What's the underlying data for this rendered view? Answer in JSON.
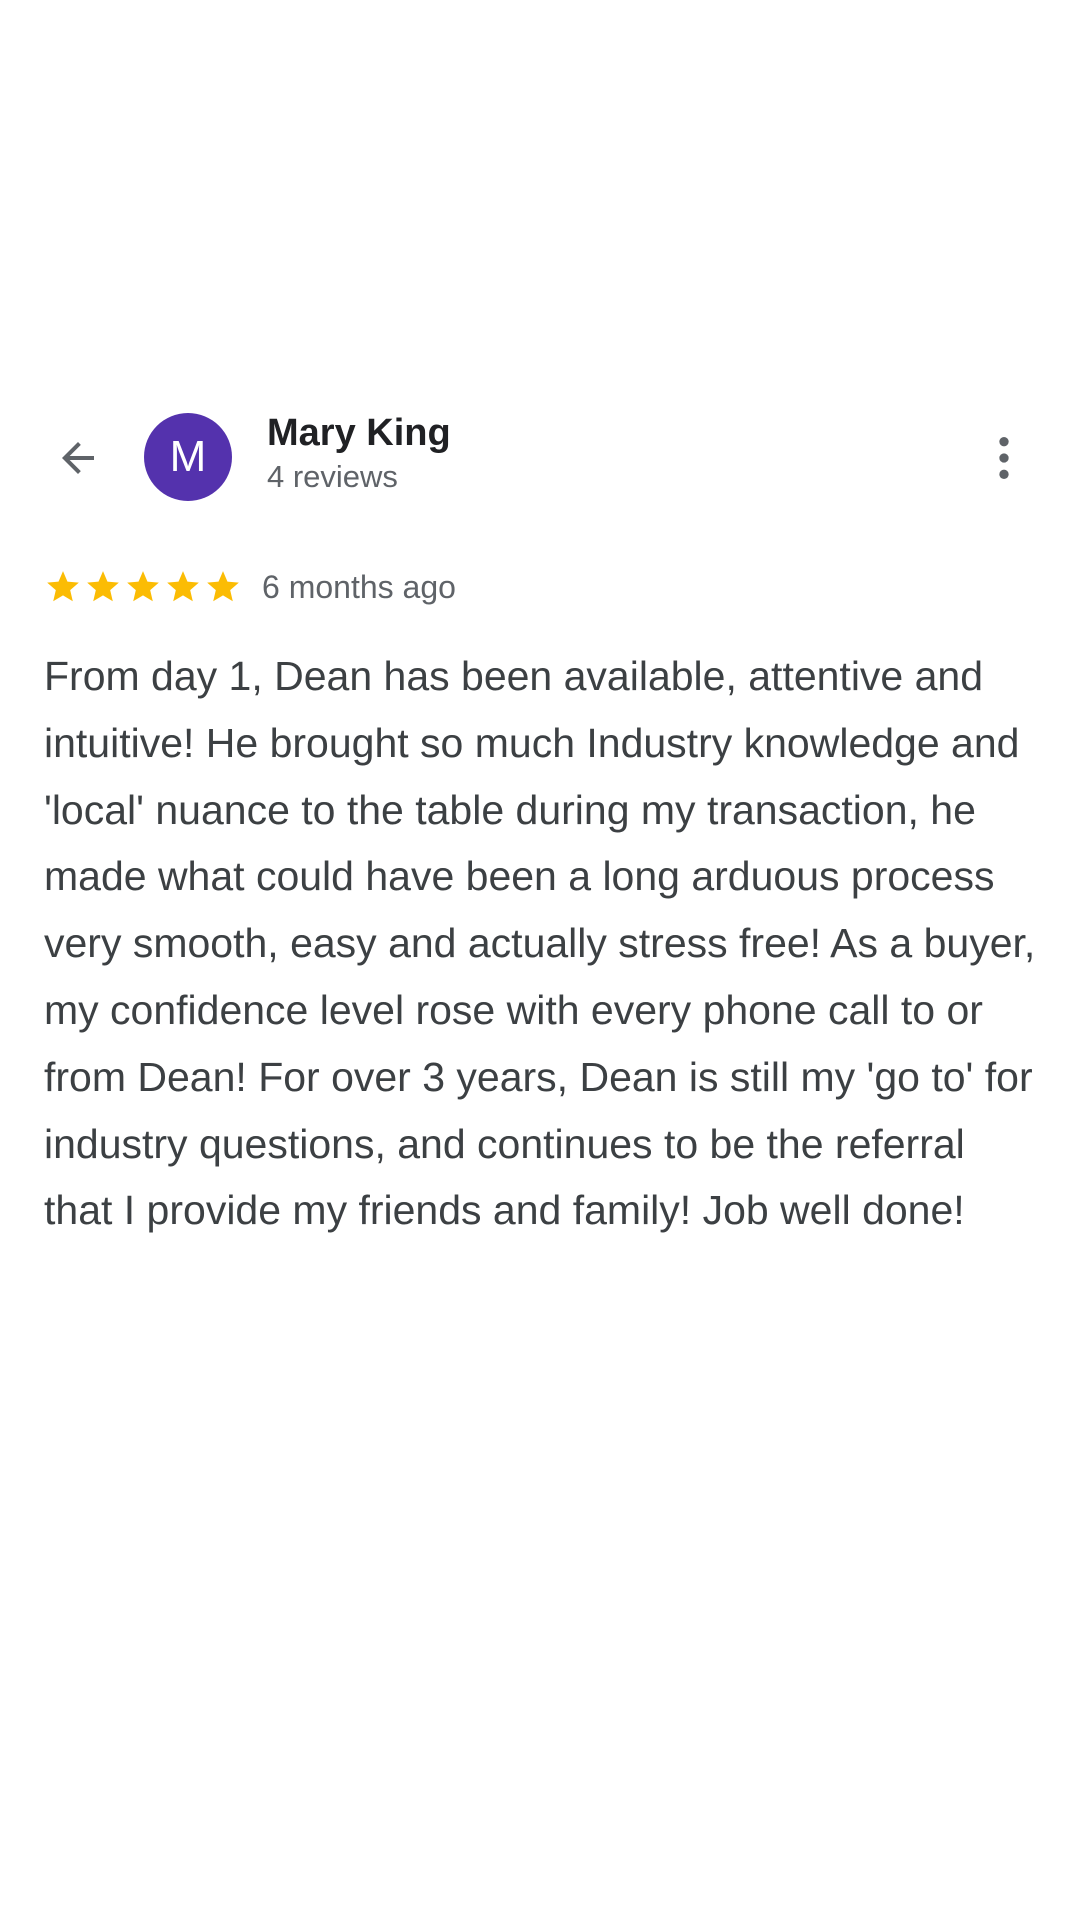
{
  "header": {
    "back_icon": "arrow-back-icon",
    "avatar_letter": "M",
    "avatar_color": "#5432ad",
    "reviewer_name": "Mary King",
    "reviewer_review_count": "4 reviews",
    "more_icon": "more-vert-icon"
  },
  "review": {
    "rating": 5,
    "rating_max": 5,
    "star_color": "#fbbc04",
    "age": "6 months ago",
    "text": "From day 1, Dean has been available, attentive and intuitive! He brought so much Industry knowledge and 'local' nuance to the table during my transaction, he made what could have been a long arduous process very smooth, easy and actually stress free! As a buyer, my confidence level rose with every phone call to or from Dean! For over 3 years, Dean is still my 'go to' for industry questions, and continues to be the referral that I provide my friends and family! Job well done!"
  }
}
